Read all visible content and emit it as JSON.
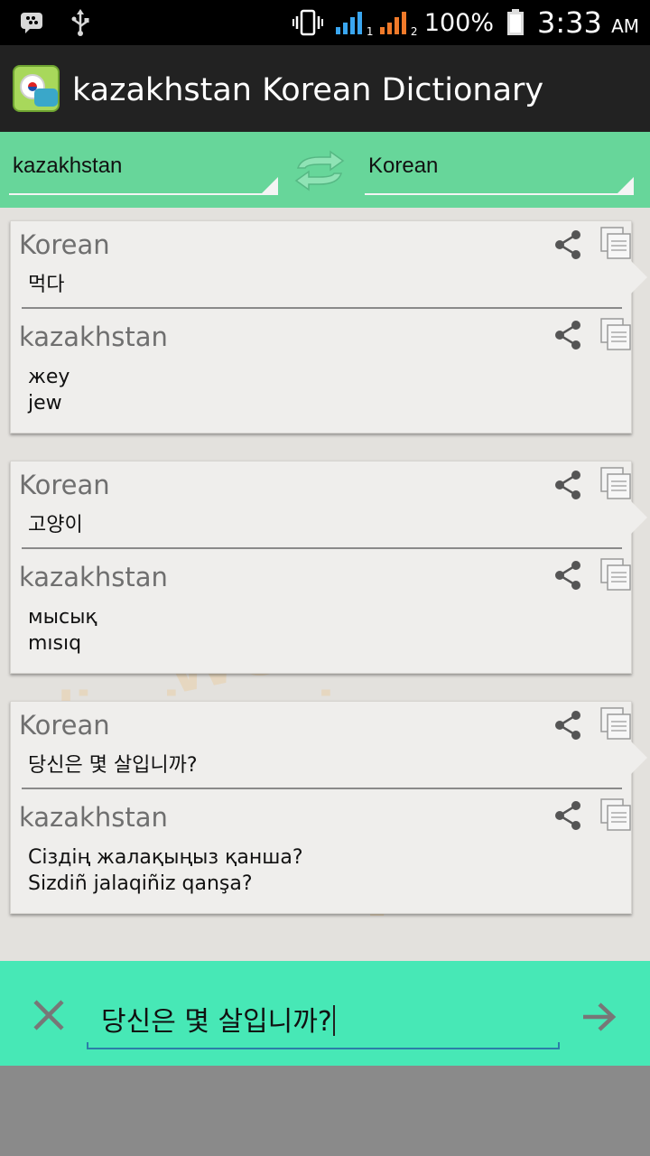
{
  "status_bar": {
    "battery_percent": "100%",
    "time": "3:33",
    "ampm": "AM",
    "sim1": "1",
    "sim2": "2",
    "icons": [
      "bbm-icon",
      "usb-icon",
      "vibrate-icon",
      "signal-icon",
      "battery-icon"
    ]
  },
  "app_bar": {
    "title": "kazakhstan Korean Dictionary"
  },
  "language_bar": {
    "source_language": "kazakhstan",
    "target_language": "Korean"
  },
  "results": [
    {
      "source_label": "Korean",
      "source_text": "먹다",
      "target_label": "kazakhstan",
      "target_lines": [
        "жеу",
        "jew"
      ]
    },
    {
      "source_label": "Korean",
      "source_text": "고양이",
      "target_label": "kazakhstan",
      "target_lines": [
        "мысық",
        "mısıq"
      ]
    },
    {
      "source_label": "Korean",
      "source_text": "당신은 몇 살입니까?",
      "target_label": "kazakhstan",
      "target_lines": [
        "Сіздің жалақыңыз қанша?",
        "Sizdiñ jalaqiñiz qanşa?"
      ]
    }
  ],
  "input_bar": {
    "value": "당신은 몇 살입니까?"
  },
  "colors": {
    "language_bar": "#67d69a",
    "input_bar": "#47e8b6",
    "action_bar": "#222222",
    "card": "#efeeec"
  }
}
